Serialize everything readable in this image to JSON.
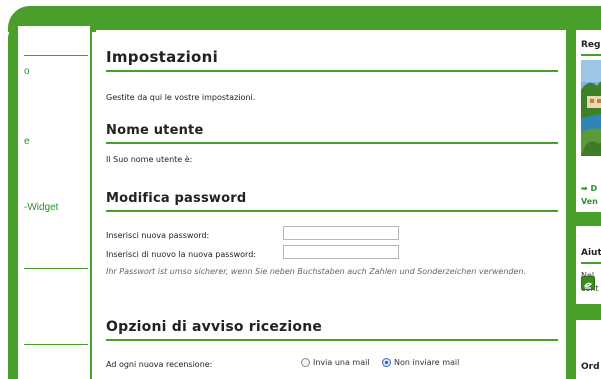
{
  "nav": {
    "items": [
      {
        "label": "o"
      },
      {
        "label": "e"
      },
      {
        "label": "-Widget"
      }
    ]
  },
  "main": {
    "title": "Impostazioni",
    "intro": "Gestite da qui le vostre impostazioni.",
    "username": {
      "heading": "Nome utente",
      "text": "Il Suo nome utente è:"
    },
    "password": {
      "heading": "Modifica password",
      "new_label": "Inserisci nuova password:",
      "repeat_label": "Inserisci di nuovo la nuova password:",
      "hint": "Ihr Passwort ist umso sicherer, wenn Sie neben Buchstaben auch Zahlen und Sonderzeichen verwenden."
    },
    "notify": {
      "heading": "Opzioni di avviso ricezione",
      "row_label": "Ad ogni nuova recensione:",
      "option_mail": "Invia una mail",
      "option_no_mail": "Non inviare mail",
      "selected": "Non inviare mail"
    }
  },
  "right_panel": {
    "box1_title": "Reg",
    "box1_link1": "➡ D",
    "box1_link2": "Ven",
    "box2_title": "Aiut",
    "box2_line1": "Nel",
    "box2_line2": "cont",
    "box3_title": "Ord"
  },
  "colors": {
    "accent": "#4a9e2a",
    "link": "#2f8f2f"
  }
}
